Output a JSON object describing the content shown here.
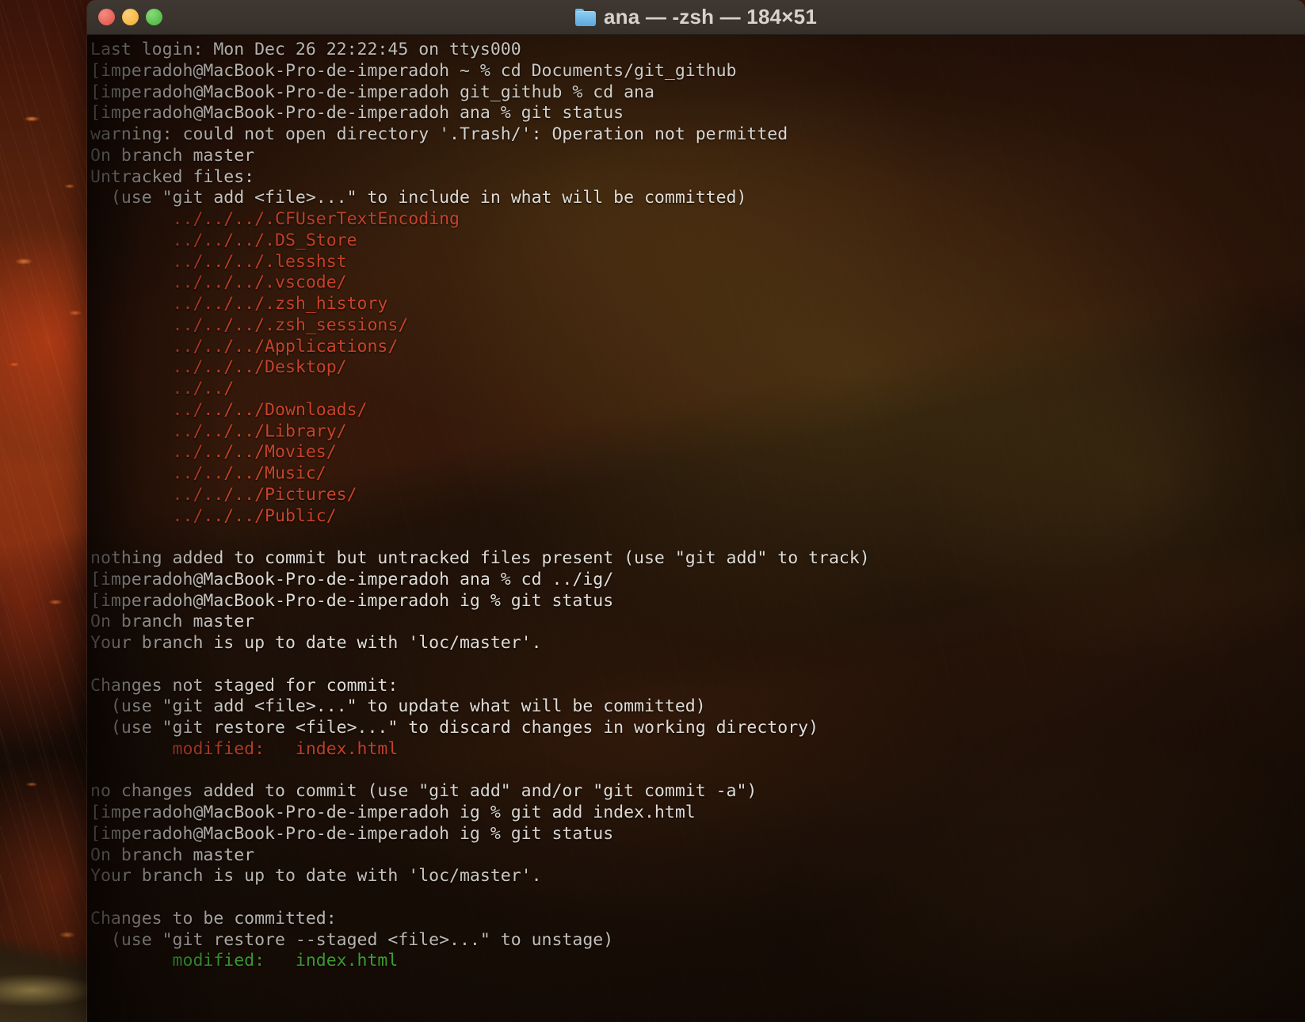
{
  "desktop": {
    "wallpaper_description": "volcanic-ember-landscape"
  },
  "window": {
    "title": "ana — -zsh — 184×51",
    "folder_icon": "blue-folder-icon",
    "controls": {
      "close": "close-button",
      "minimize": "minimize-button",
      "zoom": "zoom-button"
    },
    "colors": {
      "titlebar_bg": "#3A332E",
      "close": "#E8645A",
      "minimize": "#F4BB47",
      "zoom": "#5EC24F",
      "text_default": "#E0DCD6",
      "text_red": "#C9432B",
      "text_green": "#4BC43B"
    }
  },
  "terminal": {
    "shell": "zsh",
    "prompt_user_host": "imperadoh@MacBook-Pro-de-imperadoh",
    "lines": [
      {
        "color": "white",
        "text": "Last login: Mon Dec 26 22:22:45 on ttys000"
      },
      {
        "color": "white",
        "text": "[imperadoh@MacBook-Pro-de-imperadoh ~ % cd Documents/git_github"
      },
      {
        "color": "white",
        "text": "[imperadoh@MacBook-Pro-de-imperadoh git_github % cd ana"
      },
      {
        "color": "white",
        "text": "[imperadoh@MacBook-Pro-de-imperadoh ana % git status"
      },
      {
        "color": "white",
        "text": "warning: could not open directory '.Trash/': Operation not permitted"
      },
      {
        "color": "white",
        "text": "On branch master"
      },
      {
        "color": "white",
        "text": "Untracked files:"
      },
      {
        "color": "white",
        "text": "  (use \"git add <file>...\" to include in what will be committed)"
      },
      {
        "color": "red",
        "text": "        ../../../.CFUserTextEncoding"
      },
      {
        "color": "red",
        "text": "        ../../../.DS_Store"
      },
      {
        "color": "red",
        "text": "        ../../../.lesshst"
      },
      {
        "color": "red",
        "text": "        ../../../.vscode/"
      },
      {
        "color": "red",
        "text": "        ../../../.zsh_history"
      },
      {
        "color": "red",
        "text": "        ../../../.zsh_sessions/"
      },
      {
        "color": "red",
        "text": "        ../../../Applications/"
      },
      {
        "color": "red",
        "text": "        ../../../Desktop/"
      },
      {
        "color": "red",
        "text": "        ../../"
      },
      {
        "color": "red",
        "text": "        ../../../Downloads/"
      },
      {
        "color": "red",
        "text": "        ../../../Library/"
      },
      {
        "color": "red",
        "text": "        ../../../Movies/"
      },
      {
        "color": "red",
        "text": "        ../../../Music/"
      },
      {
        "color": "red",
        "text": "        ../../../Pictures/"
      },
      {
        "color": "red",
        "text": "        ../../../Public/"
      },
      {
        "color": "white",
        "text": ""
      },
      {
        "color": "white",
        "text": "nothing added to commit but untracked files present (use \"git add\" to track)"
      },
      {
        "color": "white",
        "text": "[imperadoh@MacBook-Pro-de-imperadoh ana % cd ../ig/"
      },
      {
        "color": "white",
        "text": "[imperadoh@MacBook-Pro-de-imperadoh ig % git status"
      },
      {
        "color": "white",
        "text": "On branch master"
      },
      {
        "color": "white",
        "text": "Your branch is up to date with 'loc/master'."
      },
      {
        "color": "white",
        "text": ""
      },
      {
        "color": "white",
        "text": "Changes not staged for commit:"
      },
      {
        "color": "white",
        "text": "  (use \"git add <file>...\" to update what will be committed)"
      },
      {
        "color": "white",
        "text": "  (use \"git restore <file>...\" to discard changes in working directory)"
      },
      {
        "color": "red",
        "text": "        modified:   index.html"
      },
      {
        "color": "white",
        "text": ""
      },
      {
        "color": "white",
        "text": "no changes added to commit (use \"git add\" and/or \"git commit -a\")"
      },
      {
        "color": "white",
        "text": "[imperadoh@MacBook-Pro-de-imperadoh ig % git add index.html"
      },
      {
        "color": "white",
        "text": "[imperadoh@MacBook-Pro-de-imperadoh ig % git status"
      },
      {
        "color": "white",
        "text": "On branch master"
      },
      {
        "color": "white",
        "text": "Your branch is up to date with 'loc/master'."
      },
      {
        "color": "white",
        "text": ""
      },
      {
        "color": "white",
        "text": "Changes to be committed:"
      },
      {
        "color": "white",
        "text": "  (use \"git restore --staged <file>...\" to unstage)"
      },
      {
        "color": "green",
        "text": "        modified:   index.html"
      }
    ]
  }
}
